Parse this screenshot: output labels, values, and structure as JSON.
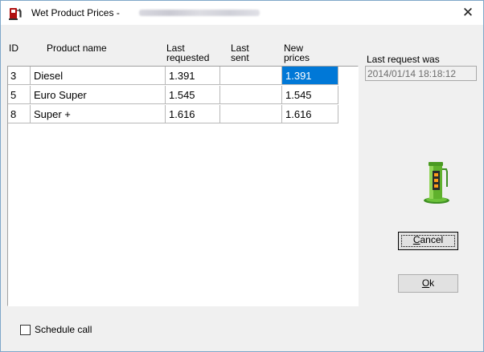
{
  "window": {
    "title": "Wet Product Prices  -",
    "close_glyph": "✕",
    "icon": "fuel-pump-icon"
  },
  "table": {
    "headers": {
      "id": "ID",
      "name": "Product name",
      "last_requested_1": "Last",
      "last_requested_2": "requested",
      "last_sent_1": "Last",
      "last_sent_2": "sent",
      "new_prices_1": "New",
      "new_prices_2": "prices"
    },
    "rows": [
      {
        "id": "3",
        "name": "Diesel",
        "last_requested": "1.391",
        "last_sent": "",
        "new_price": "1.391"
      },
      {
        "id": "5",
        "name": "Euro Super",
        "last_requested": "1.545",
        "last_sent": "",
        "new_price": "1.545"
      },
      {
        "id": "8",
        "name": "Super +",
        "last_requested": "1.616",
        "last_sent": "",
        "new_price": "1.616"
      }
    ],
    "selected_cell": "rows.0.new_price",
    "selection_color": "#0078d7"
  },
  "last_request": {
    "label": "Last request was",
    "value": "2014/01/14  18:18:12"
  },
  "buttons": {
    "cancel_mnemonic": "C",
    "cancel_rest": "ancel",
    "ok_mnemonic": "O",
    "ok_rest": "k"
  },
  "schedule": {
    "label": "Schedule call",
    "checked": false
  },
  "illustration": "fuel-pump-icon"
}
